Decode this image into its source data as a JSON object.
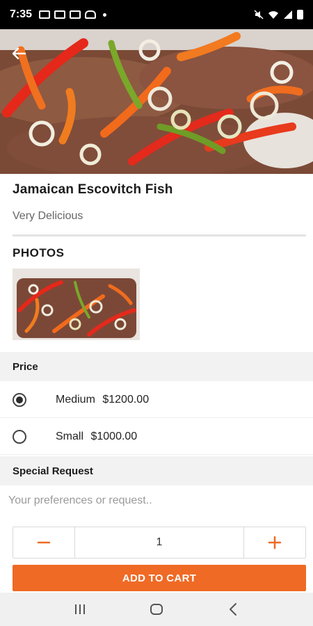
{
  "status_bar": {
    "time": "7:35",
    "icons": [
      "photo-icon",
      "mail-icon",
      "message-icon",
      "ghost-icon",
      "dot-icon",
      "mute-icon",
      "wifi-icon",
      "signal-icon",
      "battery-icon"
    ]
  },
  "item": {
    "title": "Jamaican Escovitch Fish",
    "subtitle": "Very Delicious"
  },
  "photos": {
    "heading": "PHOTOS"
  },
  "price": {
    "heading": "Price",
    "options": [
      {
        "size": "Medium",
        "price": "$1200.00",
        "selected": true
      },
      {
        "size": "Small",
        "price": "$1000.00",
        "selected": false
      }
    ]
  },
  "special_request": {
    "heading": "Special Request",
    "placeholder": "Your preferences or request..",
    "value": ""
  },
  "quantity": {
    "minus_icon": "minus-icon",
    "value": "1",
    "plus_icon": "plus-icon"
  },
  "actions": {
    "add_to_cart": "ADD TO CART"
  },
  "colors": {
    "accent": "#ef6a25",
    "status_bar": "#000000",
    "section_bg": "#f2f2f2"
  },
  "nav": {
    "icons": [
      "recents-icon",
      "home-icon",
      "back-icon"
    ]
  }
}
